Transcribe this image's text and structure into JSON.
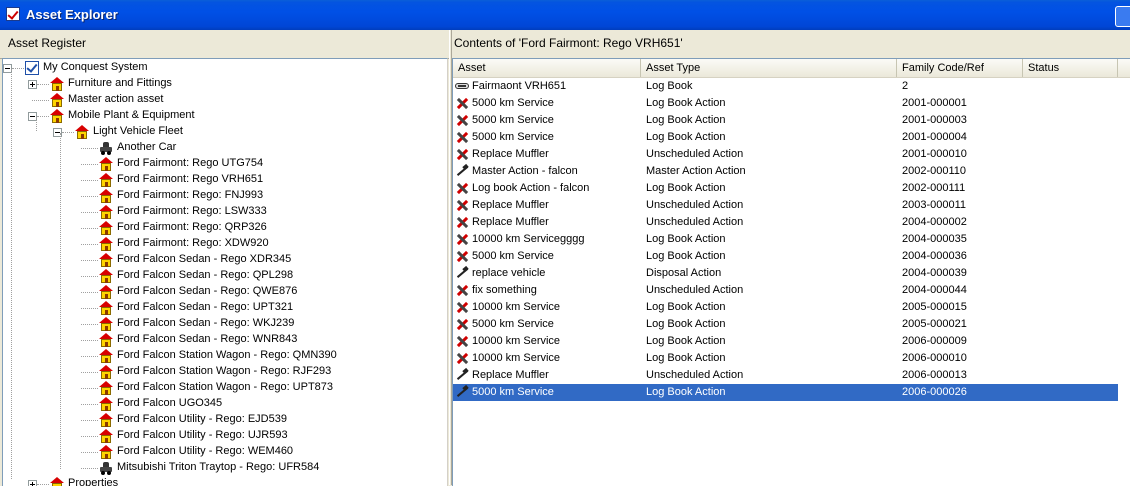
{
  "window": {
    "title": "Asset Explorer"
  },
  "left": {
    "header": "Asset Register"
  },
  "tree": [
    {
      "label": "My Conquest System",
      "level": 0,
      "icon": "check-icon",
      "expander": "minus"
    },
    {
      "label": "Furniture and Fittings",
      "level": 1,
      "icon": "house-icon",
      "expander": "plus"
    },
    {
      "label": "Master action asset",
      "level": 1,
      "icon": "house-icon",
      "expander": ""
    },
    {
      "label": "Mobile Plant & Equipment",
      "level": 1,
      "icon": "house-icon",
      "expander": "minus"
    },
    {
      "label": "Light Vehicle Fleet",
      "level": 2,
      "icon": "house-icon",
      "expander": "minus"
    },
    {
      "label": "Another Car",
      "level": 3,
      "icon": "car-icon",
      "expander": ""
    },
    {
      "label": "Ford Fairmont: Rego UTG754",
      "level": 3,
      "icon": "house-icon",
      "expander": ""
    },
    {
      "label": "Ford Fairmont: Rego VRH651",
      "level": 3,
      "icon": "house-icon",
      "expander": ""
    },
    {
      "label": "Ford Fairmont: Rego: FNJ993",
      "level": 3,
      "icon": "house-icon",
      "expander": ""
    },
    {
      "label": "Ford Fairmont: Rego: LSW333",
      "level": 3,
      "icon": "house-icon",
      "expander": ""
    },
    {
      "label": "Ford Fairmont: Rego: QRP326",
      "level": 3,
      "icon": "house-icon",
      "expander": ""
    },
    {
      "label": "Ford Fairmont: Rego: XDW920",
      "level": 3,
      "icon": "house-icon",
      "expander": ""
    },
    {
      "label": "Ford Falcon Sedan - Rego XDR345",
      "level": 3,
      "icon": "house-icon",
      "expander": ""
    },
    {
      "label": "Ford Falcon Sedan - Rego: QPL298",
      "level": 3,
      "icon": "house-icon",
      "expander": ""
    },
    {
      "label": "Ford Falcon Sedan - Rego: QWE876",
      "level": 3,
      "icon": "house-icon",
      "expander": ""
    },
    {
      "label": "Ford Falcon Sedan - Rego: UPT321",
      "level": 3,
      "icon": "house-icon",
      "expander": ""
    },
    {
      "label": "Ford Falcon Sedan - Rego: WKJ239",
      "level": 3,
      "icon": "house-icon",
      "expander": ""
    },
    {
      "label": "Ford Falcon Sedan - Rego: WNR843",
      "level": 3,
      "icon": "house-icon",
      "expander": ""
    },
    {
      "label": "Ford Falcon Station Wagon - Rego: QMN390",
      "level": 3,
      "icon": "house-icon",
      "expander": ""
    },
    {
      "label": "Ford Falcon Station Wagon - Rego: RJF293",
      "level": 3,
      "icon": "house-icon",
      "expander": ""
    },
    {
      "label": "Ford Falcon Station Wagon - Rego: UPT873",
      "level": 3,
      "icon": "house-icon",
      "expander": ""
    },
    {
      "label": "Ford Falcon UGO345",
      "level": 3,
      "icon": "house-icon",
      "expander": ""
    },
    {
      "label": "Ford Falcon Utility - Rego: EJD539",
      "level": 3,
      "icon": "house-icon",
      "expander": ""
    },
    {
      "label": "Ford Falcon Utility - Rego: UJR593",
      "level": 3,
      "icon": "house-icon",
      "expander": ""
    },
    {
      "label": "Ford Falcon Utility - Rego: WEM460",
      "level": 3,
      "icon": "house-icon",
      "expander": ""
    },
    {
      "label": "Mitsubishi Triton Traytop - Rego: UFR584",
      "level": 3,
      "icon": "car-icon",
      "expander": ""
    },
    {
      "label": "Properties",
      "level": 1,
      "icon": "house-icon",
      "expander": "plus"
    }
  ],
  "right": {
    "header": "Contents of 'Ford Fairmont: Rego VRH651'"
  },
  "columns": [
    "Asset",
    "Asset Type",
    "Family Code/Ref",
    "Status"
  ],
  "rows": [
    {
      "asset": "Fairmaont VRH651",
      "type": "Log Book",
      "code": "2",
      "status": "",
      "icon": "logbook-icon",
      "selected": false
    },
    {
      "asset": "5000 km Service",
      "type": "Log Book Action",
      "code": "2001-000001",
      "status": "",
      "icon": "action-icon",
      "selected": false
    },
    {
      "asset": "5000 km Service",
      "type": "Log Book Action",
      "code": "2001-000003",
      "status": "",
      "icon": "action-icon",
      "selected": false
    },
    {
      "asset": "5000 km Service",
      "type": "Log Book Action",
      "code": "2001-000004",
      "status": "",
      "icon": "action-icon",
      "selected": false
    },
    {
      "asset": "Replace Muffler",
      "type": "Unscheduled Action",
      "code": "2001-000010",
      "status": "",
      "icon": "action-icon",
      "selected": false
    },
    {
      "asset": "Master Action - falcon",
      "type": "Master Action Action",
      "code": "2002-000110",
      "status": "",
      "icon": "master-action-icon",
      "selected": false
    },
    {
      "asset": "Log book Action - falcon",
      "type": "Log Book Action",
      "code": "2002-000111",
      "status": "",
      "icon": "action-icon",
      "selected": false
    },
    {
      "asset": "Replace Muffler",
      "type": "Unscheduled Action",
      "code": "2003-000011",
      "status": "",
      "icon": "action-icon",
      "selected": false
    },
    {
      "asset": "Replace Muffler",
      "type": "Unscheduled Action",
      "code": "2004-000002",
      "status": "",
      "icon": "action-icon",
      "selected": false
    },
    {
      "asset": "10000 km Servicegggg",
      "type": "Log Book Action",
      "code": "2004-000035",
      "status": "",
      "icon": "action-icon",
      "selected": false
    },
    {
      "asset": "5000 km Service",
      "type": "Log Book Action",
      "code": "2004-000036",
      "status": "",
      "icon": "action-icon",
      "selected": false
    },
    {
      "asset": "replace vehicle",
      "type": "Disposal Action",
      "code": "2004-000039",
      "status": "",
      "icon": "master-action-icon",
      "selected": false
    },
    {
      "asset": "fix something",
      "type": "Unscheduled Action",
      "code": "2004-000044",
      "status": "",
      "icon": "action-icon",
      "selected": false
    },
    {
      "asset": "10000 km Service",
      "type": "Log Book Action",
      "code": "2005-000015",
      "status": "",
      "icon": "action-icon",
      "selected": false
    },
    {
      "asset": "5000 km Service",
      "type": "Log Book Action",
      "code": "2005-000021",
      "status": "",
      "icon": "action-icon",
      "selected": false
    },
    {
      "asset": "10000 km Service",
      "type": "Log Book Action",
      "code": "2006-000009",
      "status": "",
      "icon": "action-icon",
      "selected": false
    },
    {
      "asset": "10000 km Service",
      "type": "Log Book Action",
      "code": "2006-000010",
      "status": "",
      "icon": "action-icon",
      "selected": false
    },
    {
      "asset": "Replace Muffler",
      "type": "Unscheduled Action",
      "code": "2006-000013",
      "status": "",
      "icon": "master-action-icon",
      "selected": false
    },
    {
      "asset": "5000 km Service",
      "type": "Log Book Action",
      "code": "2006-000026",
      "status": "",
      "icon": "master-action-icon",
      "selected": true
    }
  ],
  "colors": {
    "selection": "#316ac5",
    "titlebar": "#0050e6",
    "chrome": "#ece9d8"
  }
}
